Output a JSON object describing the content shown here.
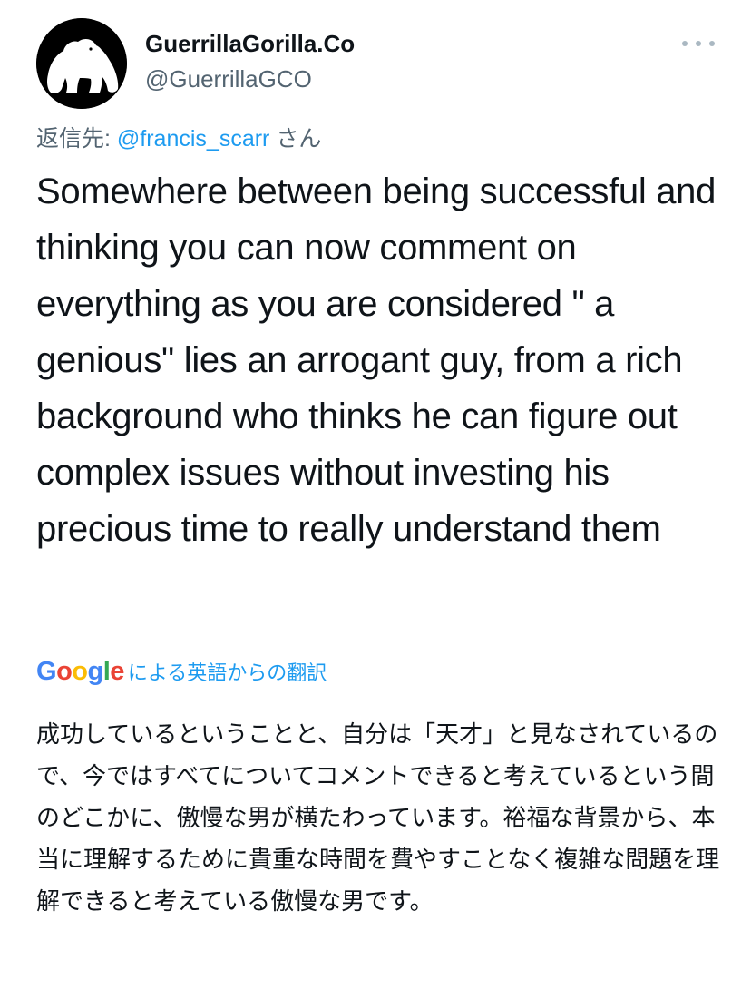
{
  "author": {
    "display_name": "GuerrillaGorilla.Co",
    "handle": "@GuerrillaGCO",
    "avatar_icon": "gorilla-avatar-icon"
  },
  "reply": {
    "prefix": "返信先: ",
    "mention": "@francis_scarr",
    "suffix": " さん"
  },
  "tweet": {
    "text": "Somewhere between being successful and thinking you can now comment on everything as you are considered \" a genious\" lies an arrogant guy, from a rich background who thinks he can figure out complex issues without investing his precious time to really understand them"
  },
  "translation": {
    "provider_letters": [
      "G",
      "o",
      "o",
      "g",
      "l",
      "e"
    ],
    "provider_colors": [
      "#4285F4",
      "#EA4335",
      "#FBBC05",
      "#4285F4",
      "#34A853",
      "#EA4335"
    ],
    "link_label": "による英語からの翻訳",
    "text": "成功しているということと、自分は「天才」と見なされているので、今ではすべてについてコメントできると考えているという間のどこかに、傲慢な男が横たわっています。裕福な背景から、本当に理解するために貴重な時間を費やすことなく複雑な問題を理解できると考えている傲慢な男です。"
  },
  "colors": {
    "link": "#1d9bf0",
    "secondary_text": "#536471",
    "primary_text": "#0f1419"
  },
  "icons": {
    "more": "more-dots-icon"
  }
}
